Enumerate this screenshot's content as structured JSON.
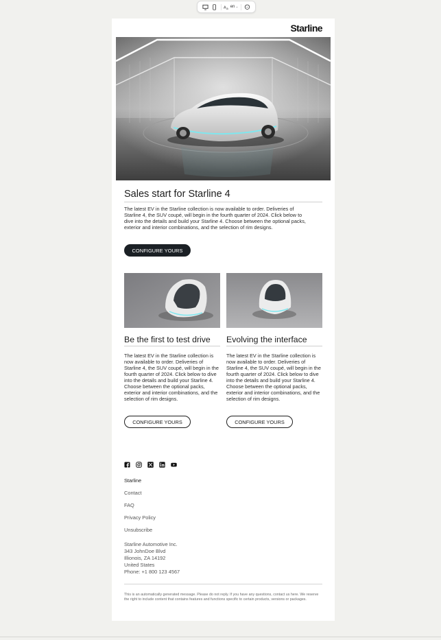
{
  "toolbar": {
    "language": "en",
    "icons": [
      "desktop-view-icon",
      "mobile-view-icon",
      "translate-icon",
      "comment-icon"
    ]
  },
  "email": {
    "brand": "Starline",
    "hero": {
      "title": "Sales start for Starline 4",
      "body": "The latest EV in the Starline collection is now available to order. Deliveries of Starline 4, the SUV coupé, will begin in the fourth quarter of 2024. Click below to dive into the details and build your Starline 4. Choose between the optional packs, exterior and interior combinations, and the selection of rim designs.",
      "button": "CONFIGURE YOURS"
    },
    "columns": [
      {
        "title": "Be the first to test drive",
        "body": "The latest EV in the Starline collection is now available to order. Deliveries of Starline 4, the SUV coupé, will begin in the fourth quarter of 2024. Click below to dive into the details and build your Starline 4. Choose between the optional packs, exterior and interior combinations, and the selection of rim designs.",
        "button": "CONFIGURE YOURS"
      },
      {
        "title": "Evolving the interface",
        "body": "The latest EV in the Starline collection is now available to order. Deliveries of Starline 4, the SUV coupé, will begin in the fourth quarter of 2024. Click below to dive into the details and build your Starline 4. Choose between the optional packs, exterior and interior combinations, and the selection of rim designs.",
        "button": "CONFIGURE YOURS"
      }
    ],
    "footer": {
      "social": [
        "facebook-icon",
        "instagram-icon",
        "x-icon",
        "linkedin-icon",
        "youtube-icon"
      ],
      "brand": "Starline",
      "links": [
        "Contact",
        "FAQ",
        "Privacy Policy",
        "Unsubscribe"
      ],
      "address": [
        "Starline Automotive Inc.",
        "343 JohnDoe Blvd",
        "Illionois, ZA 14192",
        "United States",
        "Phone: +1 800 123 4567"
      ],
      "disclaimer": "This is an automatically generated message. Please do not reply. If you have any questions, contact us here. We reserve the right to include content that contains features and functions specific to certain products, versions or packages."
    }
  }
}
